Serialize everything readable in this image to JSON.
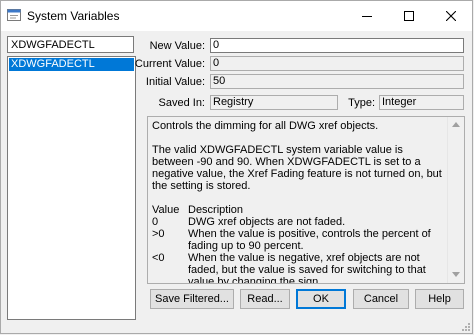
{
  "window": {
    "title": "System Variables"
  },
  "search": {
    "value": "XDWGFADECTL"
  },
  "variable_list": {
    "items": [
      "XDWGFADECTL"
    ],
    "selected": "XDWGFADECTL"
  },
  "fields": {
    "new_value_label": "New Value:",
    "new_value": "0",
    "current_value_label": "Current Value:",
    "current_value": "0",
    "initial_value_label": "Initial Value:",
    "initial_value": "50",
    "saved_in_label": "Saved In:",
    "saved_in": "Registry",
    "type_label": "Type:",
    "type": "Integer"
  },
  "description": {
    "line1": "Controls the dimming for all DWG xref objects.",
    "para2": "The valid XDWGFADECTL system variable value is between -90 and 90. When XDWGFADECTL is set to a negative value, the Xref Fading feature is not turned on, but the setting is stored.",
    "header_value": "Value",
    "header_description": "Description",
    "rows": [
      {
        "value": "0",
        "text": "DWG xref objects are not faded."
      },
      {
        "value": ">0",
        "text": "When the value is positive, controls the percent of fading up to 90 percent."
      },
      {
        "value": "<0",
        "text": "When the value is negative, xref objects are not faded, but the value is saved for switching to that value by changing the sign."
      }
    ]
  },
  "buttons": {
    "save_filtered": "Save Filtered...",
    "read": "Read...",
    "ok": "OK",
    "cancel": "Cancel",
    "help": "Help"
  },
  "colors": {
    "selection": "#0078d7",
    "window_bg": "#f0f0f0"
  }
}
